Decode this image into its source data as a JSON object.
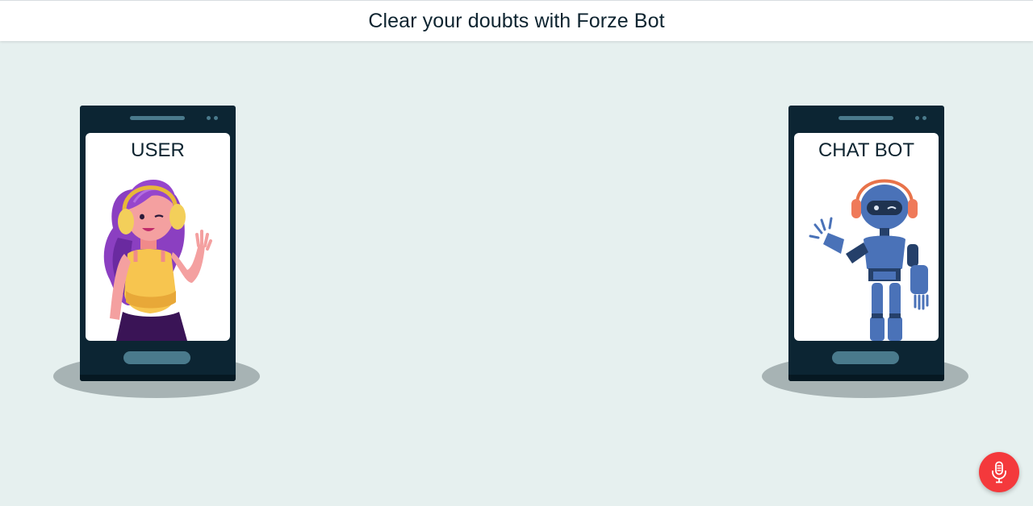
{
  "header": {
    "title": "Clear your doubts with Forze Bot"
  },
  "user_panel": {
    "label": "USER",
    "illustration": "woman-with-headphones-waving"
  },
  "bot_panel": {
    "label": "CHAT BOT",
    "illustration": "robot-with-headphones-waving"
  },
  "mic": {
    "icon": "microphone-icon",
    "color": "#f4393c"
  },
  "colors": {
    "background": "#e6f0ef",
    "phone_body": "#0c2533",
    "phone_accent": "#4a7a8c",
    "shadow": "#a7b3b4"
  }
}
